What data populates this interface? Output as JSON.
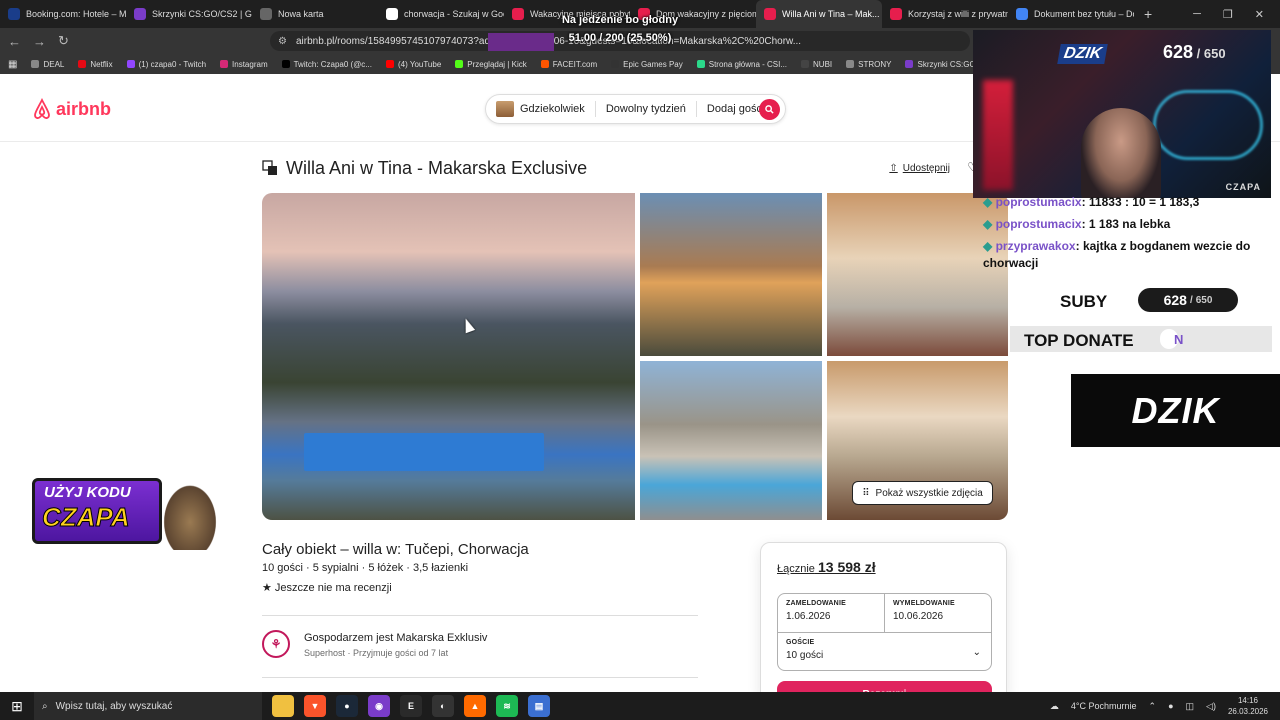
{
  "browser": {
    "tabs": [
      {
        "label": "Booking.com: Hotele – M...",
        "color": "#1a3d8a"
      },
      {
        "label": "Skrzynki CS:GO/CS2 | G4S...",
        "color": "#7a3cc9"
      },
      {
        "label": "Nowa karta",
        "color": "#666666"
      },
      {
        "label": "chorwacja - Szukaj w Goo...",
        "color": "#ffffff"
      },
      {
        "label": "Wakacyjne miejsca pobytu...",
        "color": "#e61e4d"
      },
      {
        "label": "Dom wakacyjny z pięciom...",
        "color": "#e61e4d"
      },
      {
        "label": "Willa Ani w Tina – Mak...",
        "color": "#e61e4d",
        "active": true
      },
      {
        "label": "Korzystaj z willi z prywatn...",
        "color": "#e61e4d"
      },
      {
        "label": "Dokument bez tytułu – Do...",
        "color": "#4285f4"
      }
    ],
    "url": "airbnb.pl/rooms/1584995745107974073?adults=...202...6-06-10&guests=10&location=Makarska%2C%20Chorw...",
    "bookmarks": [
      {
        "label": "DEAL",
        "color": "#888888"
      },
      {
        "label": "Netflix",
        "color": "#e50914"
      },
      {
        "label": "(1) czapa0 - Twitch",
        "color": "#9146ff"
      },
      {
        "label": "Instagram",
        "color": "#d62976"
      },
      {
        "label": "Twitch: Czapa0 (@c...",
        "color": "#000000"
      },
      {
        "label": "(4) YouTube",
        "color": "#ff0000"
      },
      {
        "label": "Przeglądaj | Kick",
        "color": "#53fc18"
      },
      {
        "label": "FACEIT.com",
        "color": "#ff5500"
      },
      {
        "label": "Epic Games Pay",
        "color": "#333333"
      },
      {
        "label": "Strona główna - CSI...",
        "color": "#2bd98a"
      },
      {
        "label": "NUBI",
        "color": "#444444"
      },
      {
        "label": "STRONY",
        "color": "#888888"
      },
      {
        "label": "Skrzynki CS:GO/CS...",
        "color": "#7a3cc9"
      }
    ]
  },
  "overlay": {
    "goal_title": "Na jedzenie bo głodny",
    "goal_value": "51.00 / 200 (25.50%)",
    "webcam_brand": "DZIK",
    "sub_count": "628",
    "sub_goal": "650",
    "webcam_name": "CZAPA",
    "chat": [
      {
        "user": "poprostumacix",
        "msg": "11833 : 10 = 1 183,3"
      },
      {
        "user": "poprostumacix",
        "msg": "1 183 na lebka"
      },
      {
        "user": "przyprawakox",
        "msg": "kajtka z bogdanem wezcie do chorwacji"
      }
    ],
    "suby_label": "SUBY",
    "top_donate_label": "TOP DONATE",
    "top_donate_tail": "N",
    "dzik_banner": "DZIK",
    "promo_line1": "UŻYJ KODU",
    "promo_line2": "CZAPA"
  },
  "airbnb": {
    "logo": "airbnb",
    "search": {
      "where": "Gdziekolwiek",
      "when": "Dowolny tydzień",
      "who": "Dodaj gości"
    },
    "title": "Willa Ani w Tina - Makarska Exclusive",
    "share": "Udostępnij",
    "show_all_photos": "Pokaż wszystkie zdjęcia",
    "property_type": "Cały obiekt – willa w: Tučepi, Chorwacja",
    "specs": "10 gości · 5 sypialni · 5 łóżek · 3,5 łazienki",
    "reviews": "★ Jeszcze nie ma recenzji",
    "host_title": "Gospodarzem jest Makarska Exklusiv",
    "host_sub": "Superhost · Przyjmuje gości od 7 lat",
    "booking": {
      "total_label": "Łącznie",
      "total_value": "13 598 zł",
      "checkin_label": "ZAMELDOWANIE",
      "checkin_value": "1.06.2026",
      "checkout_label": "WYMELDOWANIE",
      "checkout_value": "10.06.2026",
      "guests_label": "GOŚCIE",
      "guests_value": "10 gości",
      "reserve": "Rezerwuj"
    }
  },
  "taskbar": {
    "search_placeholder": "Wpisz tutaj, aby wyszukać",
    "weather": "4°C  Pochmurnie",
    "time": "14:16",
    "date": "26.03.2026"
  }
}
